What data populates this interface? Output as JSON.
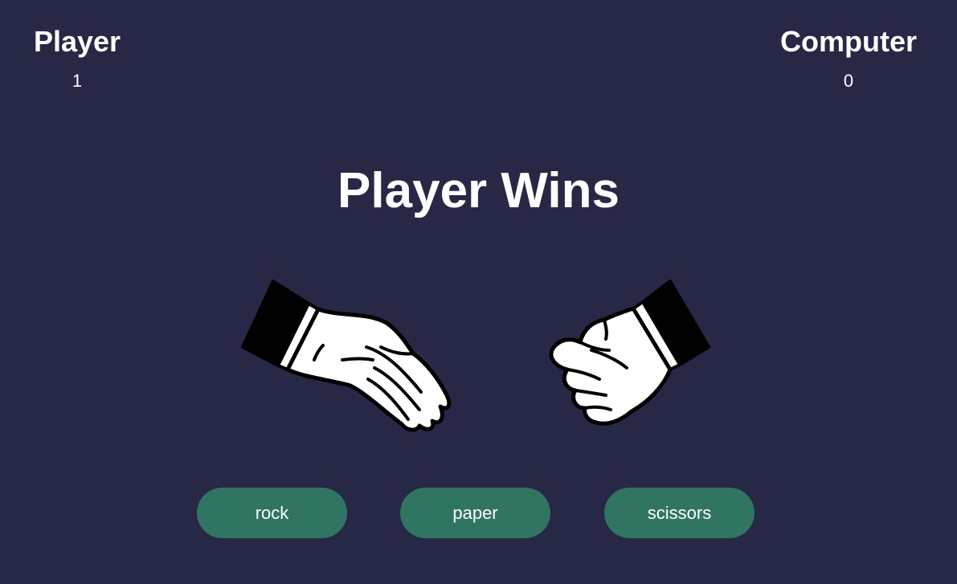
{
  "scoreboard": {
    "player": {
      "label": "Player",
      "score": "1"
    },
    "computer": {
      "label": "Computer",
      "score": "0"
    }
  },
  "result": {
    "text": "Player Wins"
  },
  "hands": {
    "player": {
      "choice": "paper",
      "icon": "paper-hand-icon"
    },
    "computer": {
      "choice": "rock",
      "icon": "rock-fist-icon"
    }
  },
  "choices": [
    {
      "label": "rock"
    },
    {
      "label": "paper"
    },
    {
      "label": "scissors"
    }
  ],
  "colors": {
    "background": "#272846",
    "button": "#2f7561",
    "text": "#ffffff"
  }
}
